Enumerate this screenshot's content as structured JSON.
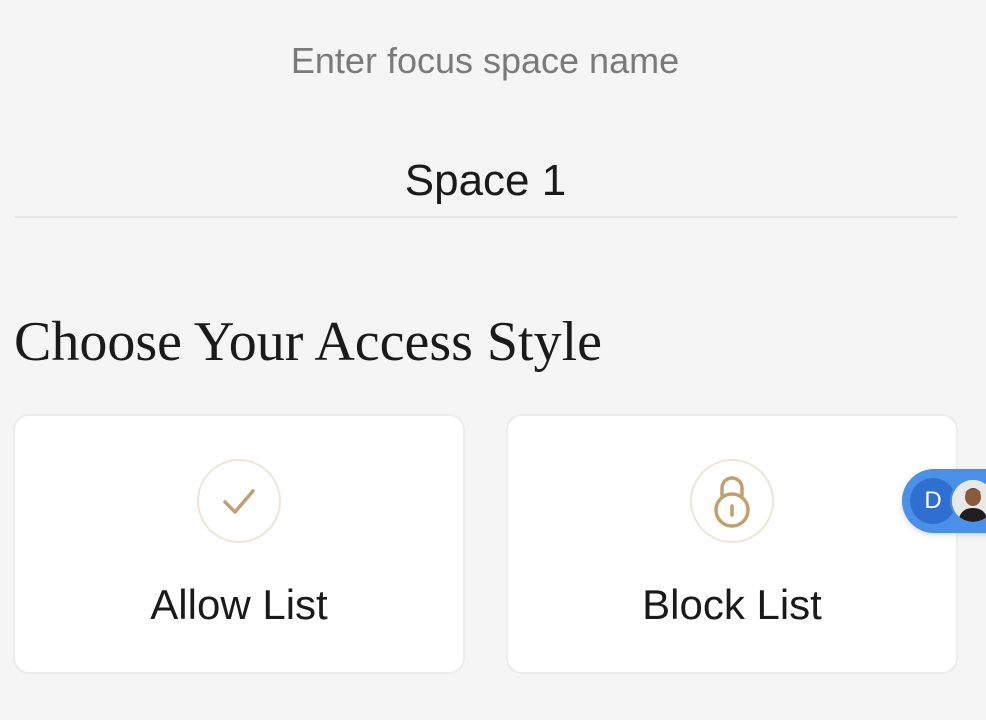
{
  "form": {
    "label": "Enter focus space name",
    "value": "Space 1"
  },
  "access": {
    "title": "Choose Your Access Style",
    "options": [
      {
        "label": "Allow List",
        "icon": "check-icon"
      },
      {
        "label": "Block List",
        "icon": "lock-icon"
      }
    ]
  },
  "chat": {
    "initial": "D"
  },
  "colors": {
    "background": "#f5f5f5",
    "accent_gold": "#c2a06d",
    "chat_blue": "#4a90e8"
  }
}
